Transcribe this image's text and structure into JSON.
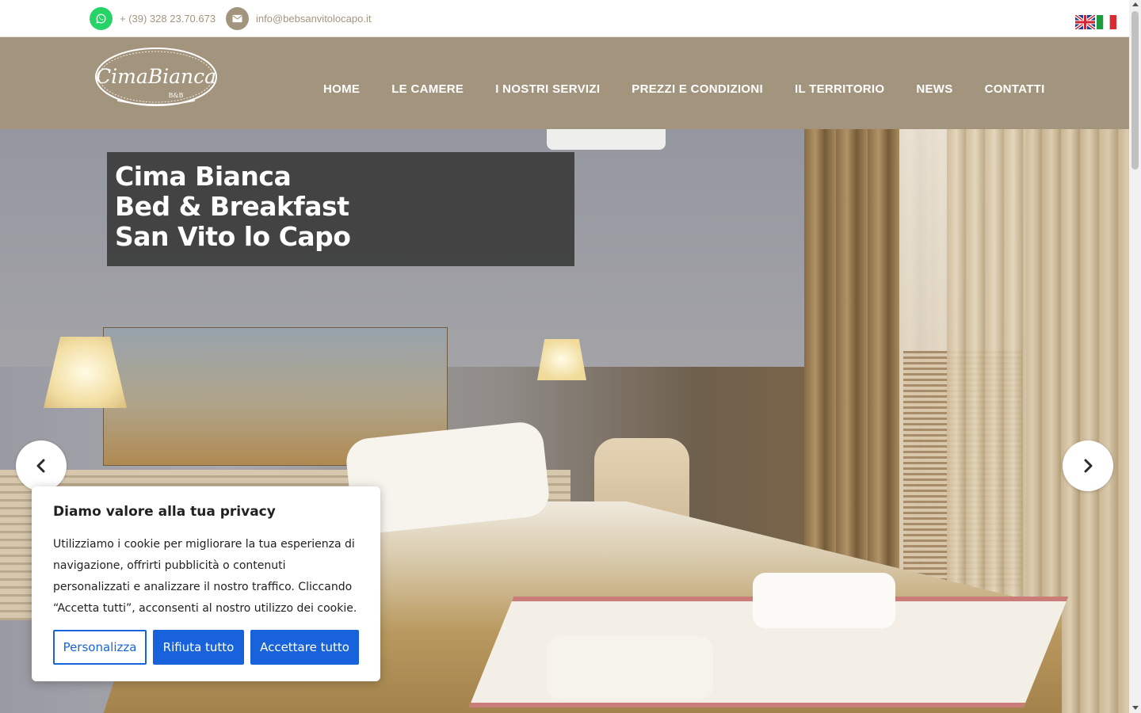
{
  "topbar": {
    "phone": "+ (39) 328 23.70.673",
    "email": "info@bebsanvitolocapo.it",
    "phone_icon": "whatsapp-icon",
    "email_icon": "envelope-icon",
    "languages": [
      "English",
      "Italiano"
    ]
  },
  "brand": {
    "logo_text": "CimaBianca",
    "logo_subtext": "B&B",
    "color": "#a3957d"
  },
  "nav": {
    "items": [
      {
        "label": "HOME"
      },
      {
        "label": "LE CAMERE"
      },
      {
        "label": "I NOSTRI SERVIZI"
      },
      {
        "label": "PREZZI E CONDIZIONI"
      },
      {
        "label": "IL TERRITORIO"
      },
      {
        "label": "NEWS"
      },
      {
        "label": "CONTATTI"
      }
    ]
  },
  "hero": {
    "caption_lines": [
      "Cima Bianca",
      "Bed & Breakfast",
      "San Vito lo Capo"
    ],
    "prev_icon": "chevron-left-icon",
    "next_icon": "chevron-right-icon"
  },
  "cookie": {
    "title": "Diamo valore alla tua privacy",
    "text": "Utilizziamo i cookie per migliorare la tua esperienza di navigazione, offrirti pubblicità o contenuti personalizzati e analizzare il nostro traffico. Cliccando “Accetta tutti”, acconsenti al nostro utilizzo dei cookie.",
    "buttons": {
      "customize": "Personalizza",
      "reject": "Rifiuta tutto",
      "accept": "Accettare tutto"
    },
    "accent": "#1863dc"
  }
}
